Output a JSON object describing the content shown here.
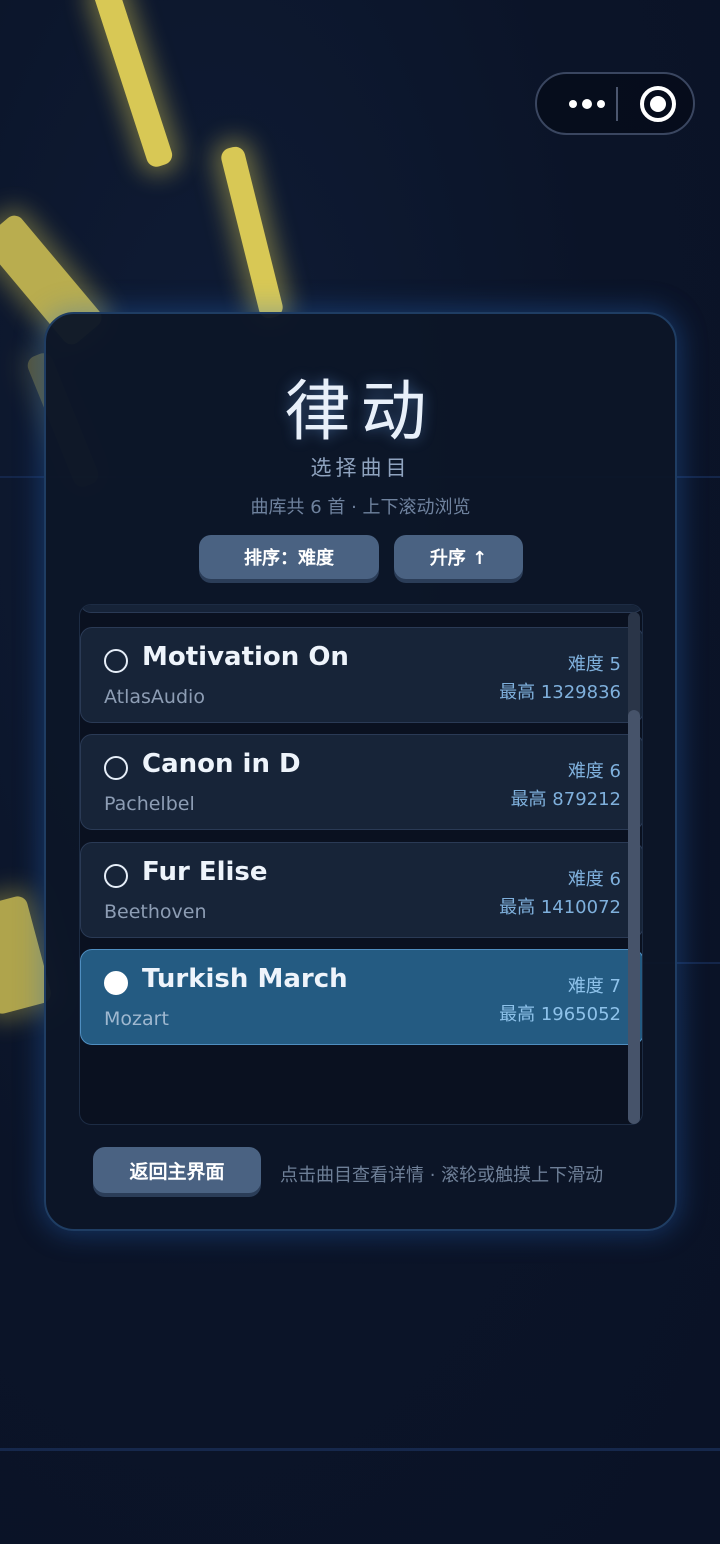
{
  "app": {
    "title": "律动",
    "subtitle": "选择曲目",
    "library_info": "曲库共 6 首 · 上下滚动浏览"
  },
  "capsule": {
    "more_icon": "more-dots-icon",
    "close_icon": "target-circle-icon"
  },
  "controls": {
    "sort_label": "排序：难度",
    "order_label": "升序 ↑"
  },
  "songs": [
    {
      "name": "Motivation On",
      "artist": "AtlasAudio",
      "difficulty": "难度 5",
      "best": "最高 1329836",
      "selected": false
    },
    {
      "name": "Canon in D",
      "artist": "Pachelbel",
      "difficulty": "难度 6",
      "best": "最高 879212",
      "selected": false
    },
    {
      "name": "Fur Elise",
      "artist": "Beethoven",
      "difficulty": "难度 6",
      "best": "最高 1410072",
      "selected": false
    },
    {
      "name": "Turkish March",
      "artist": "Mozart",
      "difficulty": "难度 7",
      "best": "最高 1965052",
      "selected": true
    }
  ],
  "footer": {
    "back_label": "返回主界面",
    "hint": "点击曲目查看详情 · 滚轮或触摸上下滑动"
  },
  "colors": {
    "background": "#0b1428",
    "panel": "#0c1628",
    "accent_selected": "#245b82",
    "glow": "#d8c855"
  }
}
